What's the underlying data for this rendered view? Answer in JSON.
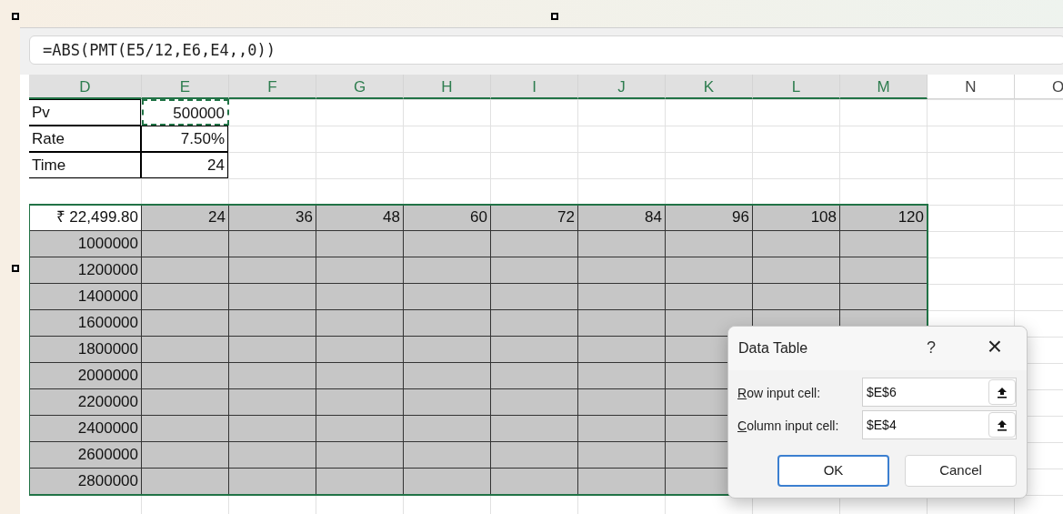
{
  "formula_bar": {
    "value": "=ABS(PMT(E5/12,E6,E4,,0))"
  },
  "columns": [
    {
      "letter": "D",
      "selected": true
    },
    {
      "letter": "E",
      "selected": true
    },
    {
      "letter": "F",
      "selected": true
    },
    {
      "letter": "G",
      "selected": true
    },
    {
      "letter": "H",
      "selected": true
    },
    {
      "letter": "I",
      "selected": true
    },
    {
      "letter": "J",
      "selected": true
    },
    {
      "letter": "K",
      "selected": true
    },
    {
      "letter": "L",
      "selected": true
    },
    {
      "letter": "M",
      "selected": true
    },
    {
      "letter": "N",
      "selected": false
    },
    {
      "letter": "O",
      "selected": false
    }
  ],
  "inputs": [
    {
      "label": "Pv",
      "value": "500000",
      "copied": true
    },
    {
      "label": "Rate",
      "value": "7.50%",
      "copied": false
    },
    {
      "label": "Time",
      "value": "24",
      "copied": false
    }
  ],
  "data_table": {
    "corner": "₹ 22,499.80",
    "column_values": [
      "24",
      "36",
      "48",
      "60",
      "72",
      "84",
      "96",
      "108",
      "120"
    ],
    "row_values": [
      "1000000",
      "1200000",
      "1400000",
      "1600000",
      "1800000",
      "2000000",
      "2200000",
      "2400000",
      "2600000",
      "2800000"
    ]
  },
  "dialog": {
    "title": "Data Table",
    "help": "?",
    "close": "×",
    "fields": [
      {
        "label": "Row input cell:",
        "value": "$E$6"
      },
      {
        "label": "Column input cell:",
        "value": "$E$4"
      }
    ],
    "buttons": [
      {
        "label": "OK",
        "default": true
      },
      {
        "label": "Cancel",
        "default": false
      }
    ]
  }
}
